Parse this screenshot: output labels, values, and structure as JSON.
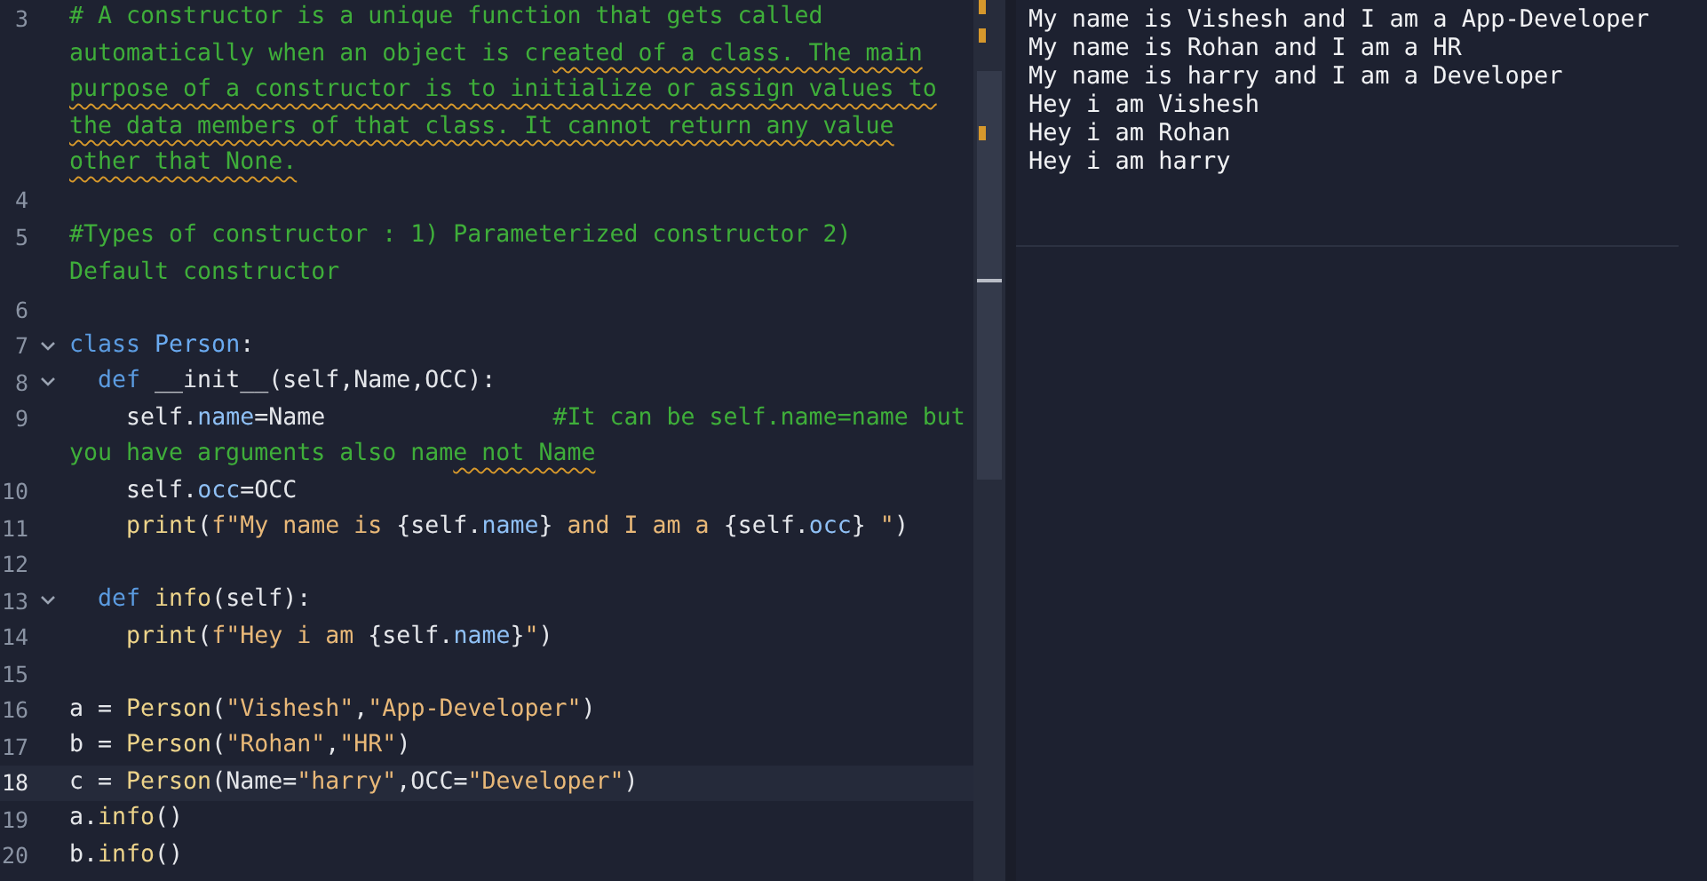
{
  "editor": {
    "lines": [
      {
        "number": "3",
        "foldable": false,
        "current": false,
        "segments": [
          [
            {
              "kind": "comment",
              "text": "# A constructor is a unique function that gets called",
              "squiggle": false
            }
          ],
          [
            {
              "kind": "comment",
              "text": "automatically when an object is cr",
              "squiggle": false
            },
            {
              "kind": "comment",
              "text": "eated of a class. The main",
              "squiggle": true
            }
          ],
          [
            {
              "kind": "comment",
              "text": "purpose of a constructor is to initialize or assign values to",
              "squiggle": true
            }
          ],
          [
            {
              "kind": "comment",
              "text": "the data members of that class. It cannot return any value",
              "squiggle": true
            }
          ],
          [
            {
              "kind": "comment",
              "text": "other that None.",
              "squiggle": true
            }
          ]
        ]
      },
      {
        "number": "4",
        "foldable": false,
        "current": false
      },
      {
        "number": "5",
        "foldable": false,
        "current": false,
        "segments": [
          [
            {
              "kind": "comment",
              "text": "#Types of constructor : 1) Parameterized constructor 2)",
              "squiggle": false
            }
          ],
          [
            {
              "kind": "comment",
              "text": "Default constructor",
              "squiggle": false
            }
          ]
        ]
      },
      {
        "number": "6",
        "foldable": false,
        "current": false
      },
      {
        "number": "7",
        "foldable": true,
        "current": false,
        "segments": [
          [
            {
              "kind": "keyword",
              "text": "class",
              "squiggle": false
            },
            {
              "kind": "type",
              "text": " Person",
              "squiggle": false
            },
            {
              "kind": "plain",
              "text": ":",
              "squiggle": false
            }
          ]
        ]
      },
      {
        "number": "8",
        "foldable": true,
        "current": false,
        "segments": [
          [
            {
              "kind": "keyword",
              "text": "  def",
              "squiggle": false
            },
            {
              "kind": "plain",
              "text": " __init__(self,Name,OCC):",
              "squiggle": false
            }
          ]
        ]
      },
      {
        "number": "9",
        "foldable": false,
        "current": false,
        "segments": [
          [
            {
              "kind": "plain",
              "text": "    self.",
              "squiggle": false
            },
            {
              "kind": "attr",
              "text": "name",
              "squiggle": false
            },
            {
              "kind": "plain",
              "text": "=Name",
              "squiggle": false
            },
            {
              "kind": "comment",
              "text": "                #It can be self.name=name but",
              "squiggle": false
            }
          ],
          [
            {
              "kind": "comment",
              "text": "you have arguments also nam",
              "squiggle": false
            },
            {
              "kind": "comment",
              "text": "e not Name",
              "squiggle": true
            }
          ]
        ]
      },
      {
        "number": "10",
        "foldable": false,
        "current": false,
        "segments": [
          [
            {
              "kind": "plain",
              "text": "    self.",
              "squiggle": false
            },
            {
              "kind": "attr",
              "text": "occ",
              "squiggle": false
            },
            {
              "kind": "plain",
              "text": "=OCC",
              "squiggle": false
            }
          ]
        ]
      },
      {
        "number": "11",
        "foldable": false,
        "current": false,
        "segments": [
          [
            {
              "kind": "func",
              "text": "    print",
              "squiggle": false
            },
            {
              "kind": "plain",
              "text": "(",
              "squiggle": false
            },
            {
              "kind": "string",
              "text": "f\"My name is ",
              "squiggle": false
            },
            {
              "kind": "plain",
              "text": "{self.",
              "squiggle": false
            },
            {
              "kind": "attr",
              "text": "name",
              "squiggle": false
            },
            {
              "kind": "plain",
              "text": "}",
              "squiggle": false
            },
            {
              "kind": "string",
              "text": " and I am a ",
              "squiggle": false
            },
            {
              "kind": "plain",
              "text": "{self.",
              "squiggle": false
            },
            {
              "kind": "attr",
              "text": "occ",
              "squiggle": false
            },
            {
              "kind": "plain",
              "text": "}",
              "squiggle": false
            },
            {
              "kind": "string",
              "text": " \"",
              "squiggle": false
            },
            {
              "kind": "plain",
              "text": ")",
              "squiggle": false
            }
          ]
        ]
      },
      {
        "number": "12",
        "foldable": false,
        "current": false
      },
      {
        "number": "13",
        "foldable": true,
        "current": false,
        "segments": [
          [
            {
              "kind": "keyword",
              "text": "  def",
              "squiggle": false
            },
            {
              "kind": "func",
              "text": " info",
              "squiggle": false
            },
            {
              "kind": "plain",
              "text": "(self):",
              "squiggle": false
            }
          ]
        ]
      },
      {
        "number": "14",
        "foldable": false,
        "current": false,
        "segments": [
          [
            {
              "kind": "func",
              "text": "    print",
              "squiggle": false
            },
            {
              "kind": "plain",
              "text": "(",
              "squiggle": false
            },
            {
              "kind": "string",
              "text": "f\"Hey i am ",
              "squiggle": false
            },
            {
              "kind": "plain",
              "text": "{self.",
              "squiggle": false
            },
            {
              "kind": "attr",
              "text": "name",
              "squiggle": false
            },
            {
              "kind": "plain",
              "text": "}",
              "squiggle": false
            },
            {
              "kind": "string",
              "text": "\"",
              "squiggle": false
            },
            {
              "kind": "plain",
              "text": ")",
              "squiggle": false
            }
          ]
        ]
      },
      {
        "number": "15",
        "foldable": false,
        "current": false
      },
      {
        "number": "16",
        "foldable": false,
        "current": false,
        "segments": [
          [
            {
              "kind": "plain",
              "text": "a = ",
              "squiggle": false
            },
            {
              "kind": "func",
              "text": "Person",
              "squiggle": false
            },
            {
              "kind": "plain",
              "text": "(",
              "squiggle": false
            },
            {
              "kind": "string",
              "text": "\"Vishesh\"",
              "squiggle": false
            },
            {
              "kind": "plain",
              "text": ",",
              "squiggle": false
            },
            {
              "kind": "string",
              "text": "\"App-Developer\"",
              "squiggle": false
            },
            {
              "kind": "plain",
              "text": ")",
              "squiggle": false
            }
          ]
        ]
      },
      {
        "number": "17",
        "foldable": false,
        "current": false,
        "segments": [
          [
            {
              "kind": "plain",
              "text": "b = ",
              "squiggle": false
            },
            {
              "kind": "func",
              "text": "Person",
              "squiggle": false
            },
            {
              "kind": "plain",
              "text": "(",
              "squiggle": false
            },
            {
              "kind": "string",
              "text": "\"Rohan\"",
              "squiggle": false
            },
            {
              "kind": "plain",
              "text": ",",
              "squiggle": false
            },
            {
              "kind": "string",
              "text": "\"HR\"",
              "squiggle": false
            },
            {
              "kind": "plain",
              "text": ")",
              "squiggle": false
            }
          ]
        ]
      },
      {
        "number": "18",
        "foldable": false,
        "current": true,
        "segments": [
          [
            {
              "kind": "plain",
              "text": "c = ",
              "squiggle": false
            },
            {
              "kind": "func",
              "text": "Person",
              "squiggle": false
            },
            {
              "kind": "plain",
              "text": "(Name=",
              "squiggle": false
            },
            {
              "kind": "string",
              "text": "\"harry\"",
              "squiggle": false
            },
            {
              "kind": "plain",
              "text": ",OCC=",
              "squiggle": false
            },
            {
              "kind": "string",
              "text": "\"Developer\"",
              "squiggle": false
            },
            {
              "kind": "plain",
              "text": ")",
              "squiggle": false
            }
          ]
        ]
      },
      {
        "number": "19",
        "foldable": false,
        "current": false,
        "segments": [
          [
            {
              "kind": "plain",
              "text": "a.",
              "squiggle": false
            },
            {
              "kind": "func",
              "text": "info",
              "squiggle": false
            },
            {
              "kind": "plain",
              "text": "()",
              "squiggle": false
            }
          ]
        ]
      },
      {
        "number": "20",
        "foldable": false,
        "current": false,
        "segments": [
          [
            {
              "kind": "plain",
              "text": "b.",
              "squiggle": false
            },
            {
              "kind": "func",
              "text": "info",
              "squiggle": false
            },
            {
              "kind": "plain",
              "text": "()",
              "squiggle": false
            }
          ]
        ]
      }
    ]
  },
  "output": {
    "lines": [
      "My name is Vishesh and I am a App-Developer",
      "My name is Rohan and I am a HR",
      "My name is harry and I am a Developer",
      "Hey i am Vishesh",
      "Hey i am Rohan",
      "Hey i am harry"
    ]
  }
}
